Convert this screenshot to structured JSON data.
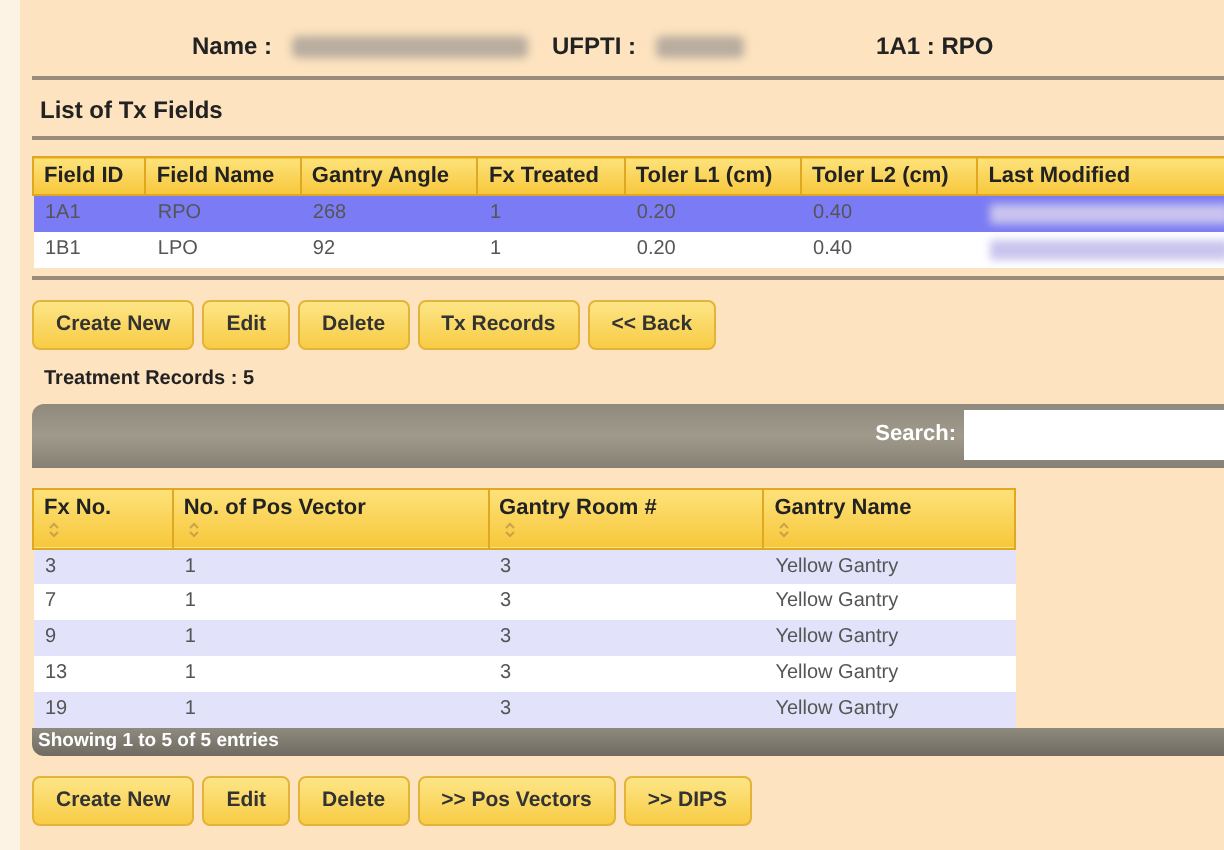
{
  "header": {
    "name_label": "Name :",
    "id_label": "UFPTI :",
    "field_label": "1A1 : RPO"
  },
  "fields_title": "List of Tx Fields",
  "fields_table": {
    "columns": [
      "Field ID",
      "Field Name",
      "Gantry Angle",
      "Fx Treated",
      "Toler L1 (cm)",
      "Toler L2 (cm)",
      "Last Modified"
    ],
    "rows": [
      {
        "cells": [
          "1A1",
          "RPO",
          "268",
          "1",
          "0.20",
          "0.40"
        ],
        "selected": true
      },
      {
        "cells": [
          "1B1",
          "LPO",
          "92",
          "1",
          "0.20",
          "0.40"
        ],
        "selected": false
      }
    ]
  },
  "field_buttons": [
    "Create New",
    "Edit",
    "Delete",
    "Tx Records",
    "<< Back"
  ],
  "records_title": "Treatment Records : 5",
  "search": {
    "label": "Search:"
  },
  "records_table": {
    "columns": [
      "Fx No.",
      "No. of Pos Vector",
      "Gantry Room #",
      "Gantry Name"
    ],
    "rows": [
      [
        "3",
        "1",
        "3",
        "Yellow Gantry"
      ],
      [
        "7",
        "1",
        "3",
        "Yellow Gantry"
      ],
      [
        "9",
        "1",
        "3",
        "Yellow Gantry"
      ],
      [
        "13",
        "1",
        "3",
        "Yellow Gantry"
      ],
      [
        "19",
        "1",
        "3",
        "Yellow Gantry"
      ]
    ]
  },
  "records_info": "Showing 1 to 5 of 5 entries",
  "record_buttons": [
    "Create New",
    "Edit",
    "Delete",
    ">> Pos Vectors",
    ">> DIPS"
  ]
}
